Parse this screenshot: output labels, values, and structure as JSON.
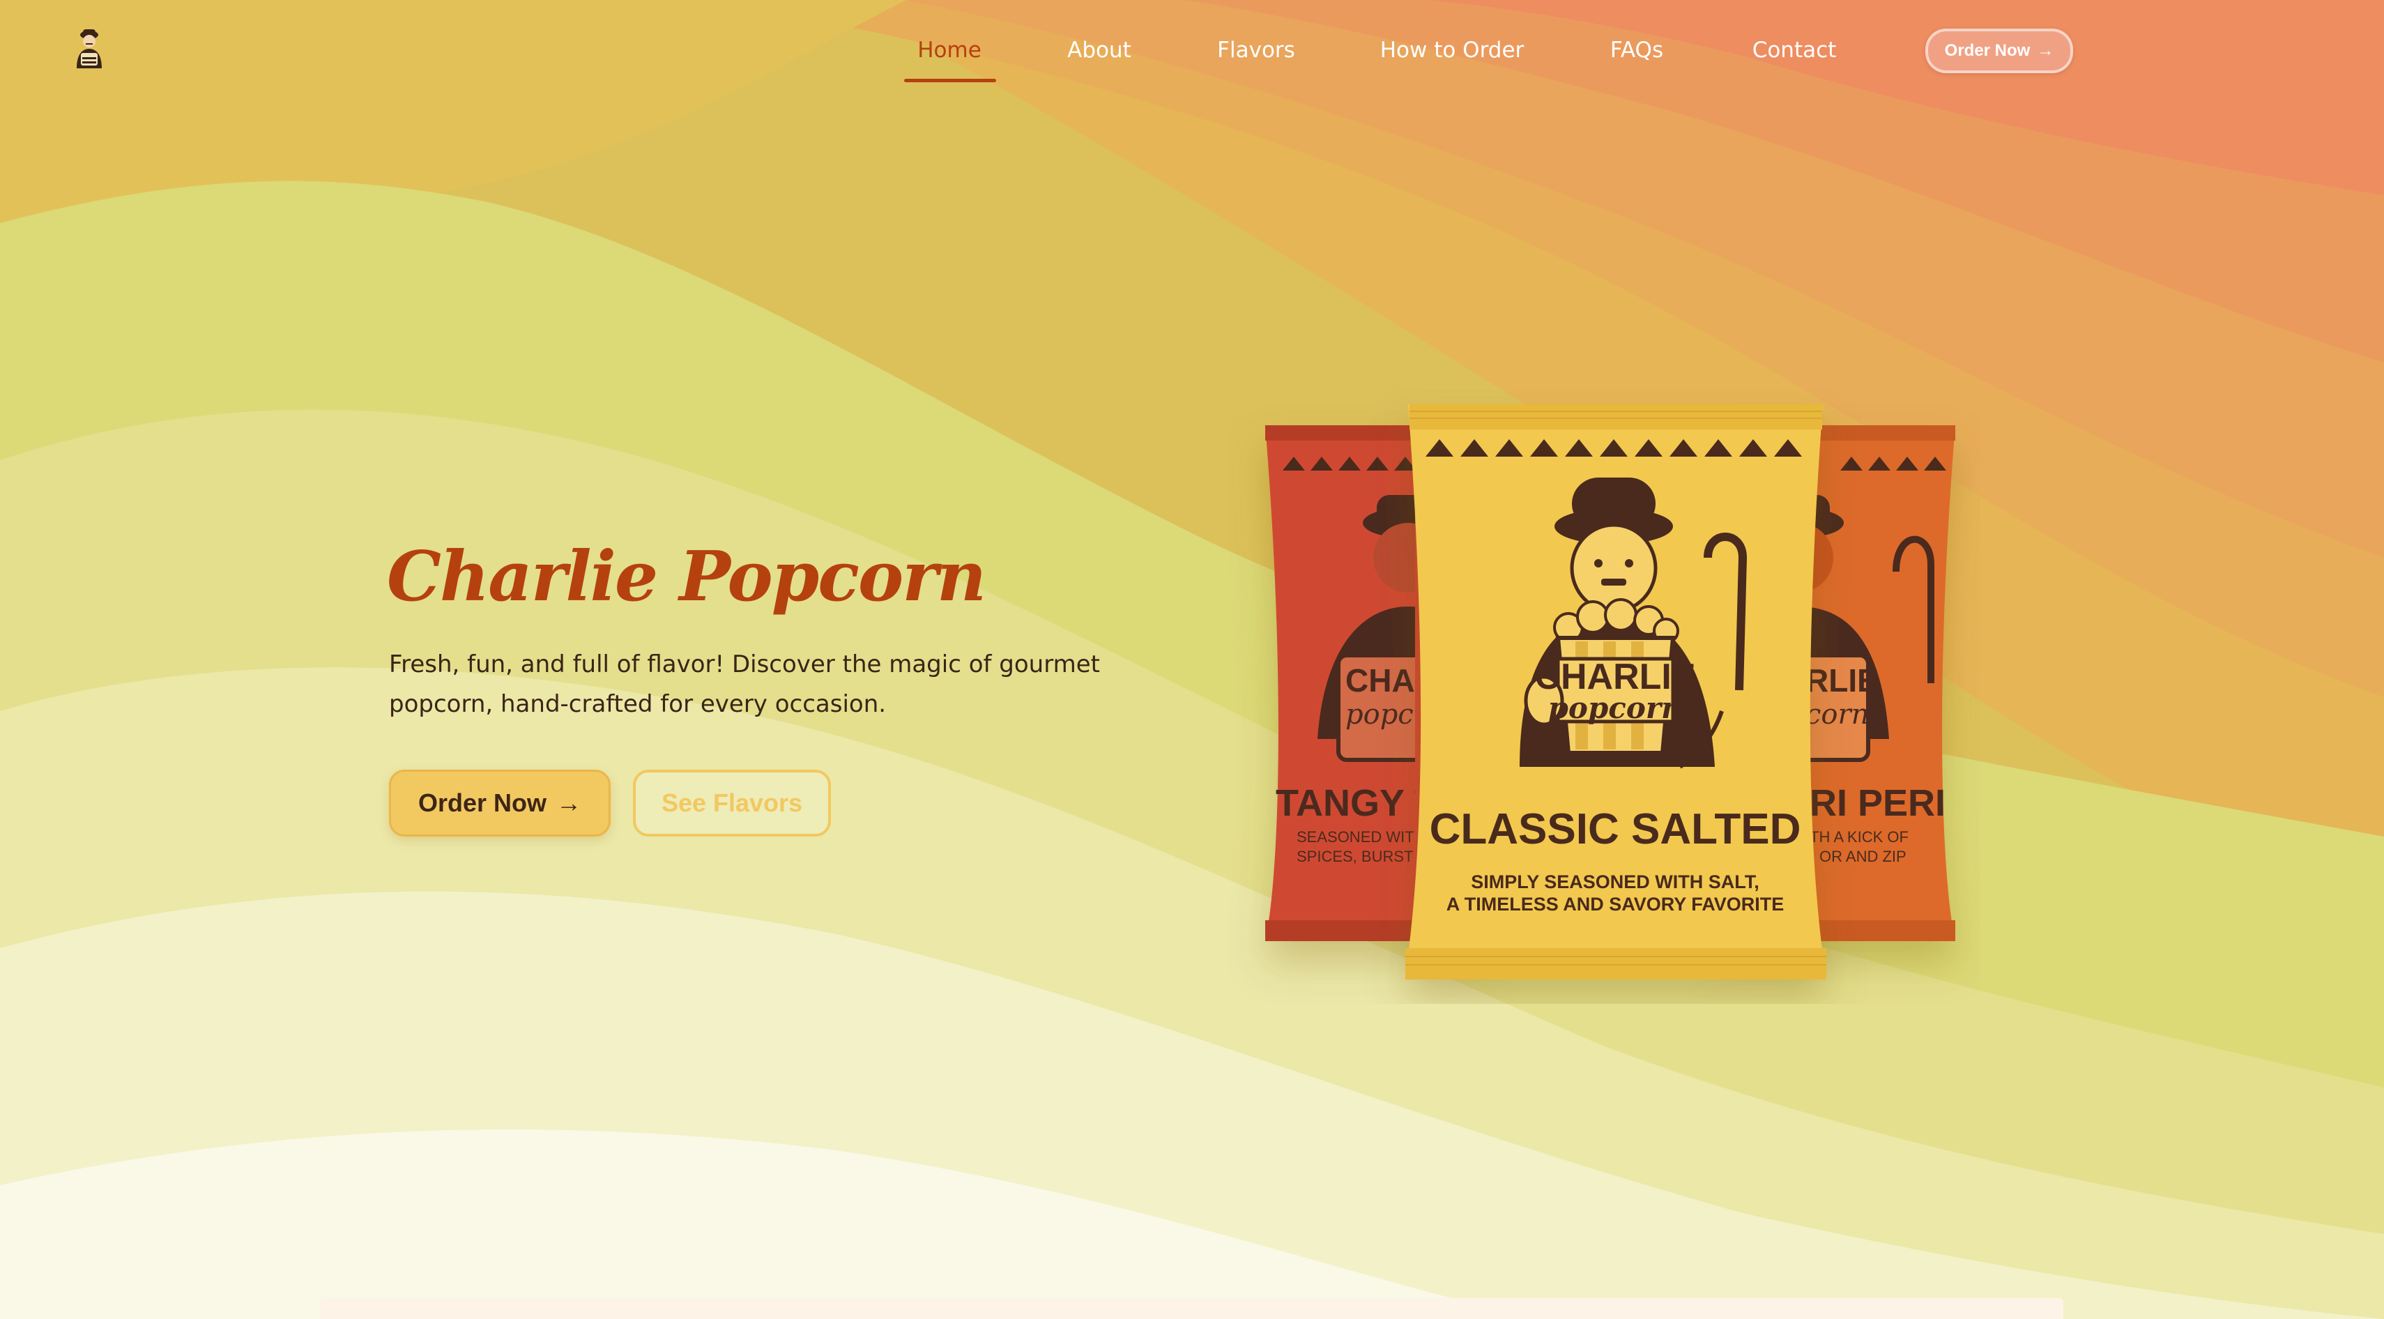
{
  "brand": {
    "logo_icon": "charlie-mascot-icon"
  },
  "nav": {
    "items": [
      {
        "label": "Home",
        "active": true
      },
      {
        "label": "About",
        "active": false
      },
      {
        "label": "Flavors",
        "active": false
      },
      {
        "label": "How to Order",
        "active": false
      },
      {
        "label": "FAQs",
        "active": false
      },
      {
        "label": "Contact",
        "active": false
      }
    ],
    "cta_label": "Order Now",
    "cta_icon": "arrow-right-icon"
  },
  "hero": {
    "title": "Charlie Popcorn",
    "subtitle": "Fresh, fun, and full of flavor! Discover the magic of gourmet popcorn, hand-crafted for every occasion.",
    "primary_button": "Order Now",
    "primary_icon": "arrow-right-icon",
    "secondary_button": "See Flavors"
  },
  "products": {
    "left": {
      "name": "TANGY T",
      "desc_line1": "SEASONED WIT",
      "desc_line2": "SPICES, BURST"
    },
    "center": {
      "brand_line1": "CHARLIE",
      "brand_line2": "popcorn",
      "name": "CLASSIC SALTED",
      "desc_line1": "SIMPLY SEASONED WITH SALT,",
      "desc_line2": "A TIMELESS AND SAVORY FAVORITE"
    },
    "right": {
      "name": "ERI PERI",
      "desc_line1": "ITH A KICK OF",
      "desc_line2": "OR AND ZIP"
    },
    "left_brand_line1": "CHAR",
    "left_brand_line2": "popc",
    "right_brand_line1": "RLIE",
    "right_brand_line2": "corn"
  },
  "colors": {
    "accent": "#b5410f",
    "button_yellow": "#f2c861",
    "bag_red": "#cf4a32",
    "bag_yellow": "#f2c84f",
    "bag_orange": "#dd6a2a",
    "bag_ink": "#4a2a1e"
  }
}
